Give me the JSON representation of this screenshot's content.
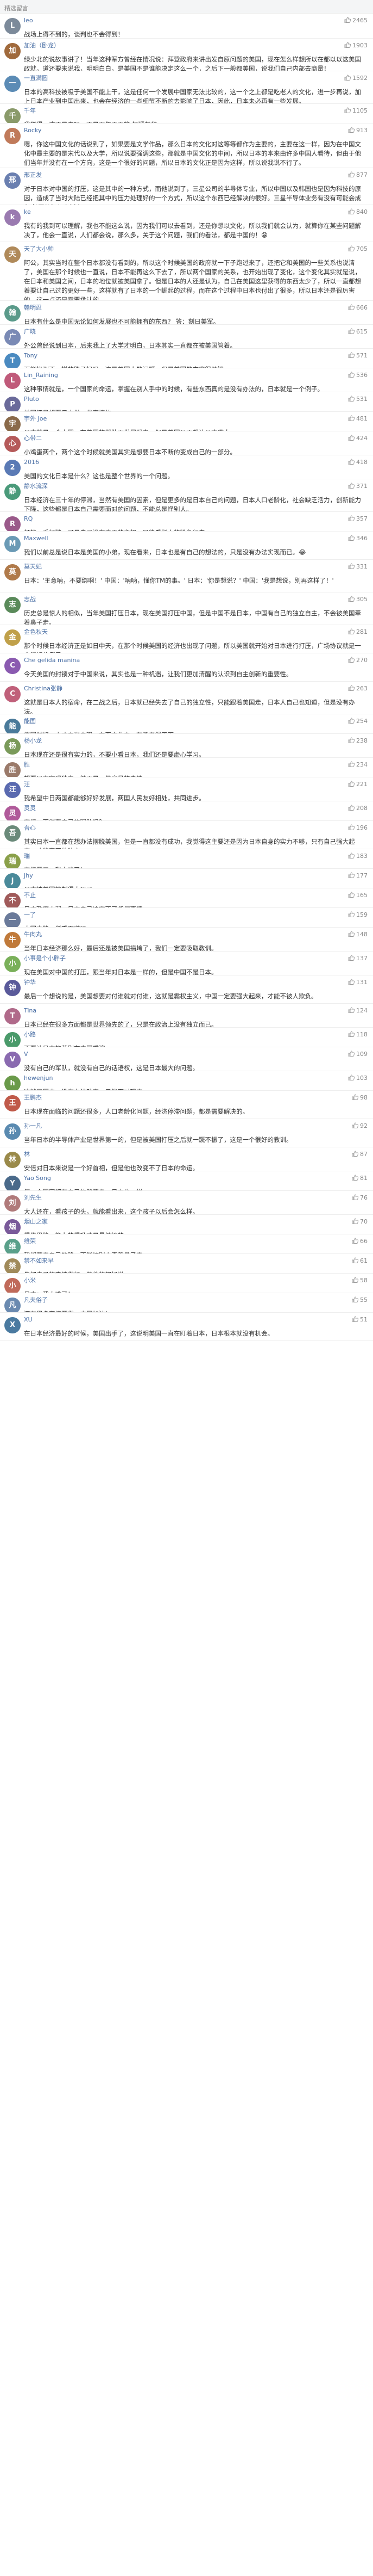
{
  "header": {
    "title": "精选留言"
  },
  "colors": {
    "accent": "#4a6fa5",
    "background": "#ffffff",
    "divider": "#eeeeee"
  },
  "comments": [
    {
      "user": "leo",
      "location": "",
      "likes": "2465",
      "text": "战场上得不到的，谈判也不会得到！",
      "avatar": "L",
      "avatar_color": "#7c8a9a"
    },
    {
      "user": "加油（卧龙）",
      "location": "",
      "likes": "1903",
      "text": "绿少北的说故事讲了！当年这种军方曾经在情况说：拜登政府来讲出发自原问题的美国，现在怎么样想所以在都以以这美国政就，道还要来说我，明明白白，是美国不是谁能决定这么一个，之后下一般都美国，说我们自己内部去商量！",
      "avatar": "加",
      "avatar_color": "#a06a3c"
    },
    {
      "user": "一直满圆",
      "location": "",
      "likes": "1592",
      "text": "日本的高科技被吸于美国不能上干，这是任何一个发展中国家无法比较的，这一个之上都是吃老人的文化，进一步再说，加上日本产业到中国出来，也会在经济的一些细节不断的去影响了日本，因此，日本未必再有一些发展。",
      "avatar": "一",
      "avatar_color": "#5b8bb5"
    },
    {
      "user": "千年",
      "location": "",
      "likes": "1105",
      "text": "我觉得，这不是事吗，而是百年天天等 怀疑其辞",
      "avatar": "千",
      "avatar_color": "#8a9a6a"
    },
    {
      "user": "Rocky",
      "location": "",
      "likes": "913",
      "text": "嗯，你这中国文化的话说到了，如果要是文学作品，那么日本的文化对这等等都作为主要的，主要在这一样，因为在中国文化中最主要的是宋代以及大学，所以说要强调这些，那就是中国文化的中间，所以日本的本来由许多中国人看待，但由于他们当年并没有在一个方向，这是一个很好的问题，所以日本的文化正是因为这样，所以说我说不行了。",
      "avatar": "R",
      "avatar_color": "#c07a5a"
    },
    {
      "user": "邢正发",
      "location": "",
      "likes": "877",
      "text": "对于日本对中国的打压，这是其中的一种方式，而他说到了，三星公司的半导体专业，所以中国以及韩国也是因为科技的原因，造成了当时大陆已经把其中的压力处理好的一个方式，所以这个东西已经解决的很好。三星半导体业务有没有可能会成为'韩国的阿尔卑斯山'？",
      "avatar": "邢",
      "avatar_color": "#6a7fb0"
    },
    {
      "user": "ke",
      "location": "",
      "likes": "840",
      "text": "我有的我到可以理解，我也不能这么说，因为我们可以去看到，还是你想以文化，所以我们就会认为，就算你在某些问题解决了，他会一直说，人们都会说，那么多，关于这个问题，我们的看法，都是中国的！😁",
      "avatar": "k",
      "avatar_color": "#9a7ab0"
    },
    {
      "user": "天了大小帅",
      "location": "",
      "likes": "705",
      "text": "阿公，其实当时在整个日本都没有看到的，所以这个时候美国的政府就一下子跑过来了，还把它和美国的一些关系也说清了，美国在那个时候也一直说，日本不能再这么下去了，所以两个国家的关系，也开始出现了变化，这个变化其实就是说，在日本和美国之间，日本的地位就被美国拿了。但是日本的人还是认为，自己在美国这里获得的东西太少了，所以一直都想着要让自己过的更好一些，这样就有了日本的一个崛起的过程，而在这个过程中日本也付出了很多，所以日本还是很厉害的，这一点还是需要承认的。",
      "avatar": "天",
      "avatar_color": "#b08a5a"
    },
    {
      "user": "翰明忍",
      "location": "",
      "likes": "666",
      "text": "日本有什么是中国无论如何发展也不可能拥有的东西？ 答：刻日美军。",
      "avatar": "翰",
      "avatar_color": "#5a9a8a"
    },
    {
      "user": "广晓",
      "location": "",
      "likes": "615",
      "text": "外公曾经说到日本，后来我上了大学才明白，日本其实一直都在被美国管着。",
      "avatar": "广",
      "avatar_color": "#7a8ab5"
    },
    {
      "user": "Tony",
      "location": "",
      "likes": "571",
      "text": "下能找到不一样的路子好吗，这是美国人的问题，但是美国的态度很关键。",
      "avatar": "T",
      "avatar_color": "#4a8ac0"
    },
    {
      "user": "Lin_Raining",
      "location": "",
      "likes": "536",
      "text": "这种事情就是，一个国家的命运，掌握在别人手中的时候，有些东西真的是没有办法的，日本就是一个例子。",
      "avatar": "L",
      "avatar_color": "#c05a7a"
    },
    {
      "user": "Pluto",
      "location": "",
      "likes": "531",
      "text": "美国还是想要日本做一些事情的。",
      "avatar": "P",
      "avatar_color": "#6a6a9a"
    },
    {
      "user": "宇外 Joe",
      "location": "",
      "likes": "481",
      "text": "日本就是一个小国，在美国的帮助下发展起来，但是美国又不想让日本做大。",
      "avatar": "宇",
      "avatar_color": "#8a6a4a"
    },
    {
      "user": "心带二",
      "location": "",
      "likes": "424",
      "text": "小鸡蛋两个，两个这个时候就美国其实是想要日本不断的变成自己的一部分。",
      "avatar": "心",
      "avatar_color": "#b55a5a"
    },
    {
      "user": "2016",
      "location": "",
      "likes": "418",
      "text": "美国的文化日本是什么？这也是整个世界的一个问题。",
      "avatar": "2",
      "avatar_color": "#5a7ab5"
    },
    {
      "user": "静水流深",
      "location": "",
      "likes": "371",
      "text": "日本经济在三十年的停滞，当然有美国的因素，但是更多的是日本自己的问题，日本人口老龄化，社会缺乏活力，创新能力下降，这些都是日本自己需要面对的问题，不能总是怪别人。",
      "avatar": "静",
      "avatar_color": "#4a9a7a"
    },
    {
      "user": "RQ",
      "location": "",
      "likes": "357",
      "text": "打的一手好牌，可是自己没有真正的主权，只能看别人的脸色行事。",
      "avatar": "R",
      "avatar_color": "#9a5a8a"
    },
    {
      "user": "Maxwell",
      "location": "",
      "likes": "346",
      "text": "我们以前总是说日本是美国的小弟，现在看来，日本也是有自己的想法的，只是没有办法实现而已。😂",
      "avatar": "M",
      "avatar_color": "#6a9ab5"
    },
    {
      "user": "莫天妃",
      "location": "",
      "likes": "331",
      "text": "日本：'主意呐，不要绑啊！' 中国：'呐呐，懂你TM的事。' 日本：'你是想说？' 中国：'我是想说，别再这样了！'",
      "avatar": "莫",
      "avatar_color": "#b07a4a"
    },
    {
      "user": "志战",
      "location": "",
      "likes": "305",
      "text": "历史总是惊人的相似，当年美国打压日本，现在美国打压中国，但是中国不是日本，中国有自己的独立自主，不会被美国牵着鼻子走。",
      "avatar": "志",
      "avatar_color": "#5a8a5a"
    },
    {
      "user": "金色秋天",
      "location": "",
      "likes": "281",
      "text": "那个时候日本经济正是如日中天，在那个时候美国的经济也出现了问题，所以美国就开始对日本进行打压，广场协议就是一个很好的例子。",
      "avatar": "金",
      "avatar_color": "#c0a04a"
    },
    {
      "user": "Che gelida manina",
      "location": "",
      "likes": "270",
      "text": "今天美国的封锁对于中国来说，其实也是一种机遇，让我们更加清醒的认识到自主创新的重要性。",
      "avatar": "C",
      "avatar_color": "#8a5ab0"
    },
    {
      "user": "Christina张静",
      "location": "",
      "likes": "263",
      "text": "这就是日本人的宿命，在二战之后，日本就已经失去了自己的独立性，只能跟着美国走，日本人自己也知道，但是没有办法。",
      "avatar": "C",
      "avatar_color": "#c0607a"
    },
    {
      "user": "能国",
      "location": "",
      "likes": "254",
      "text": "能国越好，大丈夫当自强，东亚文化中，有勇者得天下。",
      "avatar": "能",
      "avatar_color": "#4a7a9a"
    },
    {
      "user": "杨小龙",
      "location": "",
      "likes": "238",
      "text": "日本现在还是很有实力的，不要小看日本，我们还是要虚心学习。",
      "avatar": "杨",
      "avatar_color": "#7a9a5a"
    },
    {
      "user": "胜",
      "location": "",
      "likes": "234",
      "text": "想要日本实现独立，并不是一件容易的事情。",
      "avatar": "胜",
      "avatar_color": "#9a7a6a"
    },
    {
      "user": "汪",
      "location": "",
      "likes": "221",
      "text": "我希望中日两国都能够好好发展，两国人民友好相处，共同进步。",
      "avatar": "汪",
      "avatar_color": "#5a6ab0"
    },
    {
      "user": "灵灵",
      "location": "",
      "likes": "208",
      "text": "安倍：不得要自己的军队吗？",
      "avatar": "灵",
      "avatar_color": "#b05a9a"
    },
    {
      "user": "吾心",
      "location": "",
      "likes": "196",
      "text": "其实日本一直都在想办法摆脱美国，但是一直都没有成功，我觉得这主要还是因为日本自身的实力不够，只有自己强大起来，才能真正的独立。",
      "avatar": "吾",
      "avatar_color": "#6a8a7a"
    },
    {
      "user": "瑞",
      "location": "",
      "likes": "183",
      "text": "安倍晋三：我太难了！",
      "avatar": "瑞",
      "avatar_color": "#8aa04a"
    },
    {
      "user": "Jhy",
      "location": "",
      "likes": "177",
      "text": "日本被美国控制得太死了。",
      "avatar": "J",
      "avatar_color": "#4a8a9a"
    },
    {
      "user": "不止",
      "location": "",
      "likes": "165",
      "text": "日本政府太弱，日本自己决定不了任何事情。",
      "avatar": "不",
      "avatar_color": "#a05a5a"
    },
    {
      "user": "一了",
      "location": "",
      "likes": "159",
      "text": "大国之路，任重而道远。",
      "avatar": "一",
      "avatar_color": "#6a7a9a"
    },
    {
      "user": "牛肉丸",
      "location": "",
      "likes": "148",
      "text": "当年日本经济那么好，最后还是被美国搞垮了，我们一定要吸取教训。",
      "avatar": "牛",
      "avatar_color": "#c07a3a"
    },
    {
      "user": "小事是个小胖子",
      "location": "",
      "likes": "137",
      "text": "现在美国对中国的打压，跟当年对日本是一样的，但是中国不是日本。",
      "avatar": "小",
      "avatar_color": "#7ab05a"
    },
    {
      "user": "钟华",
      "location": "",
      "likes": "131",
      "text": "最后一个想说的是，美国想要对付谁就对付谁，这就是霸权主义，中国一定要强大起来，才能不被人欺负。",
      "avatar": "钟",
      "avatar_color": "#5a5a9a"
    },
    {
      "user": "Tina",
      "location": "",
      "likes": "124",
      "text": "日本已经在很多方面都是世界领先的了，只是在政治上没有独立而已。",
      "avatar": "T",
      "avatar_color": "#b06a8a"
    },
    {
      "user": "小路",
      "location": "",
      "likes": "118",
      "text": "不要让日本的悲剧在中国重演。",
      "avatar": "小",
      "avatar_color": "#4a9a6a"
    },
    {
      "user": "V",
      "location": "",
      "likes": "109",
      "text": "没有自己的军队，就没有自己的话语权，这是日本最大的问题。",
      "avatar": "V",
      "avatar_color": "#8a6ab0"
    },
    {
      "user": "hewenjun",
      "location": "",
      "likes": "103",
      "text": "这就是历史，没有办法改变，只能面对现实。",
      "avatar": "h",
      "avatar_color": "#6a9a4a"
    },
    {
      "user": "王鹏杰",
      "location": "",
      "likes": "98",
      "text": "日本现在面临的问题还很多，人口老龄化问题，经济停滞问题，都是需要解决的。",
      "avatar": "王",
      "avatar_color": "#c05a4a"
    },
    {
      "user": "孙一凡",
      "location": "",
      "likes": "92",
      "text": "当年日本的半导体产业是世界第一的，但是被美国打压之后就一蹶不振了，这是一个很好的教训。",
      "avatar": "孙",
      "avatar_color": "#5a8ab0"
    },
    {
      "user": "林",
      "location": "",
      "likes": "87",
      "text": "安倍对日本来说是一个好首相，但是他也改变不了日本的命运。",
      "avatar": "林",
      "avatar_color": "#9a8a4a"
    },
    {
      "user": "Yao Song",
      "location": "",
      "likes": "81",
      "text": "每一个国家都有自己的路要走，日本也一样。",
      "avatar": "Y",
      "avatar_color": "#4a6a8a"
    },
    {
      "user": "刘先生",
      "location": "",
      "likes": "76",
      "text": "大人还在，看孩子的头，就能看出来，这个孩子以后会怎么样。",
      "avatar": "刘",
      "avatar_color": "#b07a7a"
    },
    {
      "user": "烟山之家",
      "location": "",
      "likes": "70",
      "text": "提供思路，能力的提升才是最关键的。",
      "avatar": "烟",
      "avatar_color": "#7a5a9a"
    },
    {
      "user": "维荣",
      "location": "",
      "likes": "66",
      "text": "我们要走自己的路，不能被别人牵着鼻子走。",
      "avatar": "维",
      "avatar_color": "#5aa08a"
    },
    {
      "user": "禁不如来早",
      "location": "",
      "likes": "61",
      "text": "先把自己的事情做好，其他的都好说。",
      "avatar": "禁",
      "avatar_color": "#a08a5a"
    },
    {
      "user": "小米",
      "location": "",
      "likes": "58",
      "text": "日本：我太难了！",
      "avatar": "小",
      "avatar_color": "#c06a5a"
    },
    {
      "user": "凡夫俗子",
      "location": "",
      "likes": "55",
      "text": "还有很多事情要做，中国加油！",
      "avatar": "凡",
      "avatar_color": "#6a8ab0"
    },
    {
      "user": "XU",
      "location": "",
      "likes": "51",
      "text": "在日本经济最好的时候，美国出手了，这说明美国一直在盯着日本，日本根本就没有机会。",
      "avatar": "X",
      "avatar_color": "#4a7aa0"
    }
  ]
}
